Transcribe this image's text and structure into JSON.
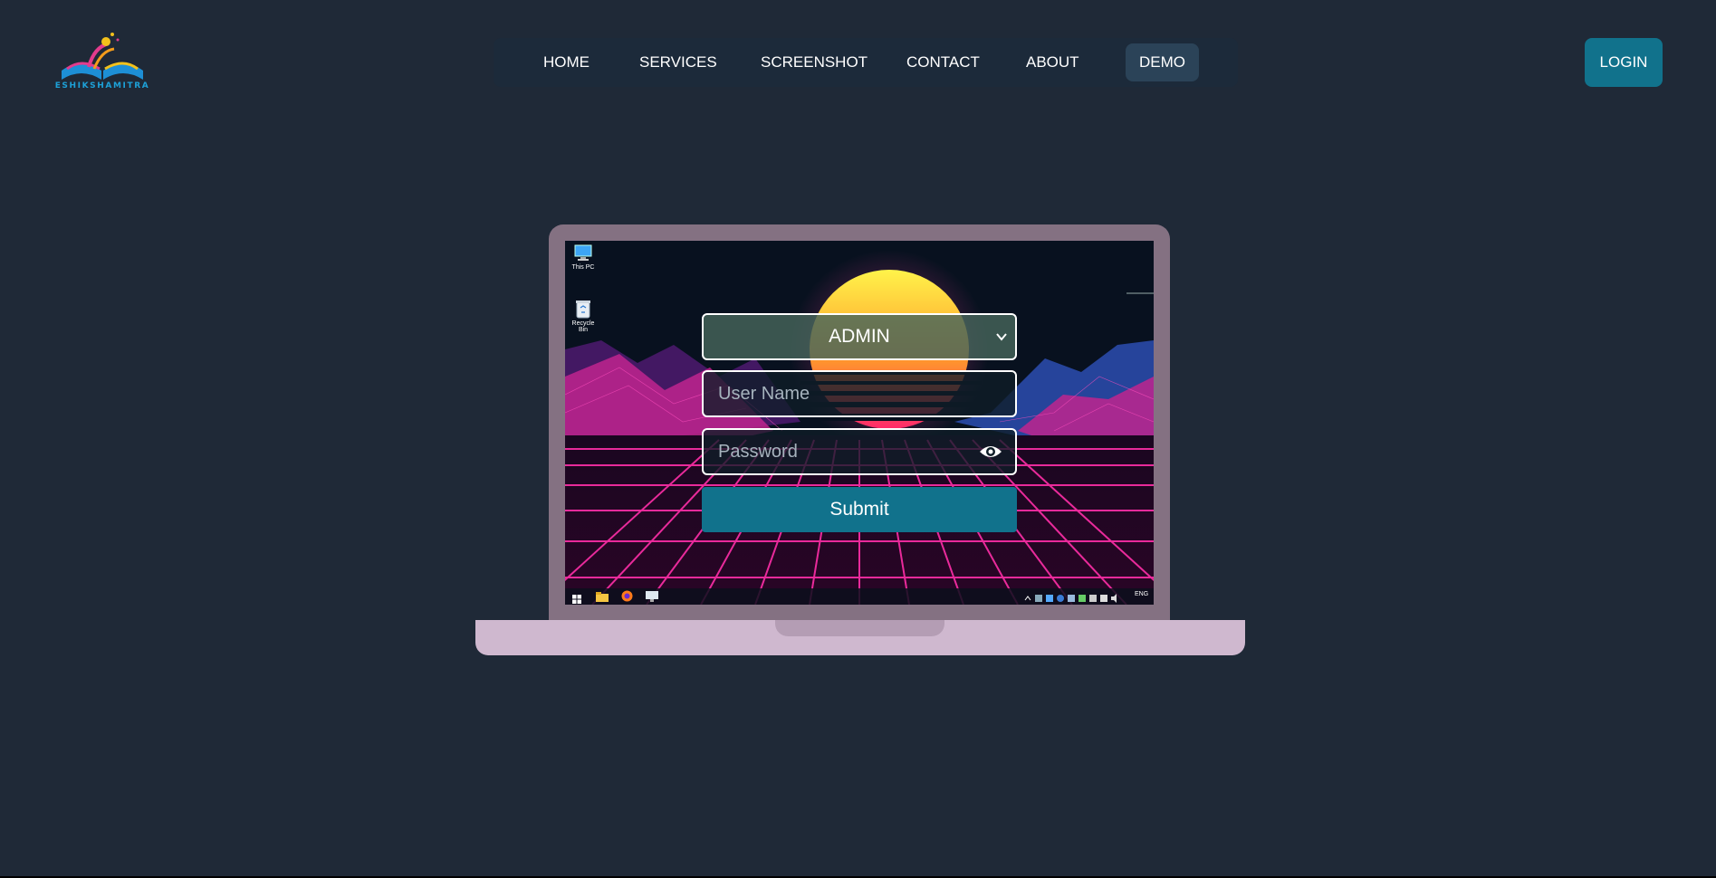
{
  "brand": {
    "logo_text": "ESHIKSHAMITRA",
    "accent": "#11728c"
  },
  "nav": {
    "items": [
      {
        "label": "HOME"
      },
      {
        "label": "SERVICES"
      },
      {
        "label": "SCREENSHOT"
      },
      {
        "label": "CONTACT"
      },
      {
        "label": "ABOUT"
      },
      {
        "label": "DEMO",
        "active": true
      }
    ]
  },
  "header": {
    "login_label": "LOGIN"
  },
  "desktop": {
    "icons": [
      {
        "label": "This PC",
        "icon": "computer-icon"
      },
      {
        "label": "Recycle Bin",
        "icon": "recycle-bin-icon"
      }
    ],
    "taskbar": {
      "language": "ENG"
    }
  },
  "login_form": {
    "role_selected": "ADMIN",
    "username_placeholder": "User Name",
    "password_placeholder": "Password",
    "submit_label": "Submit"
  }
}
